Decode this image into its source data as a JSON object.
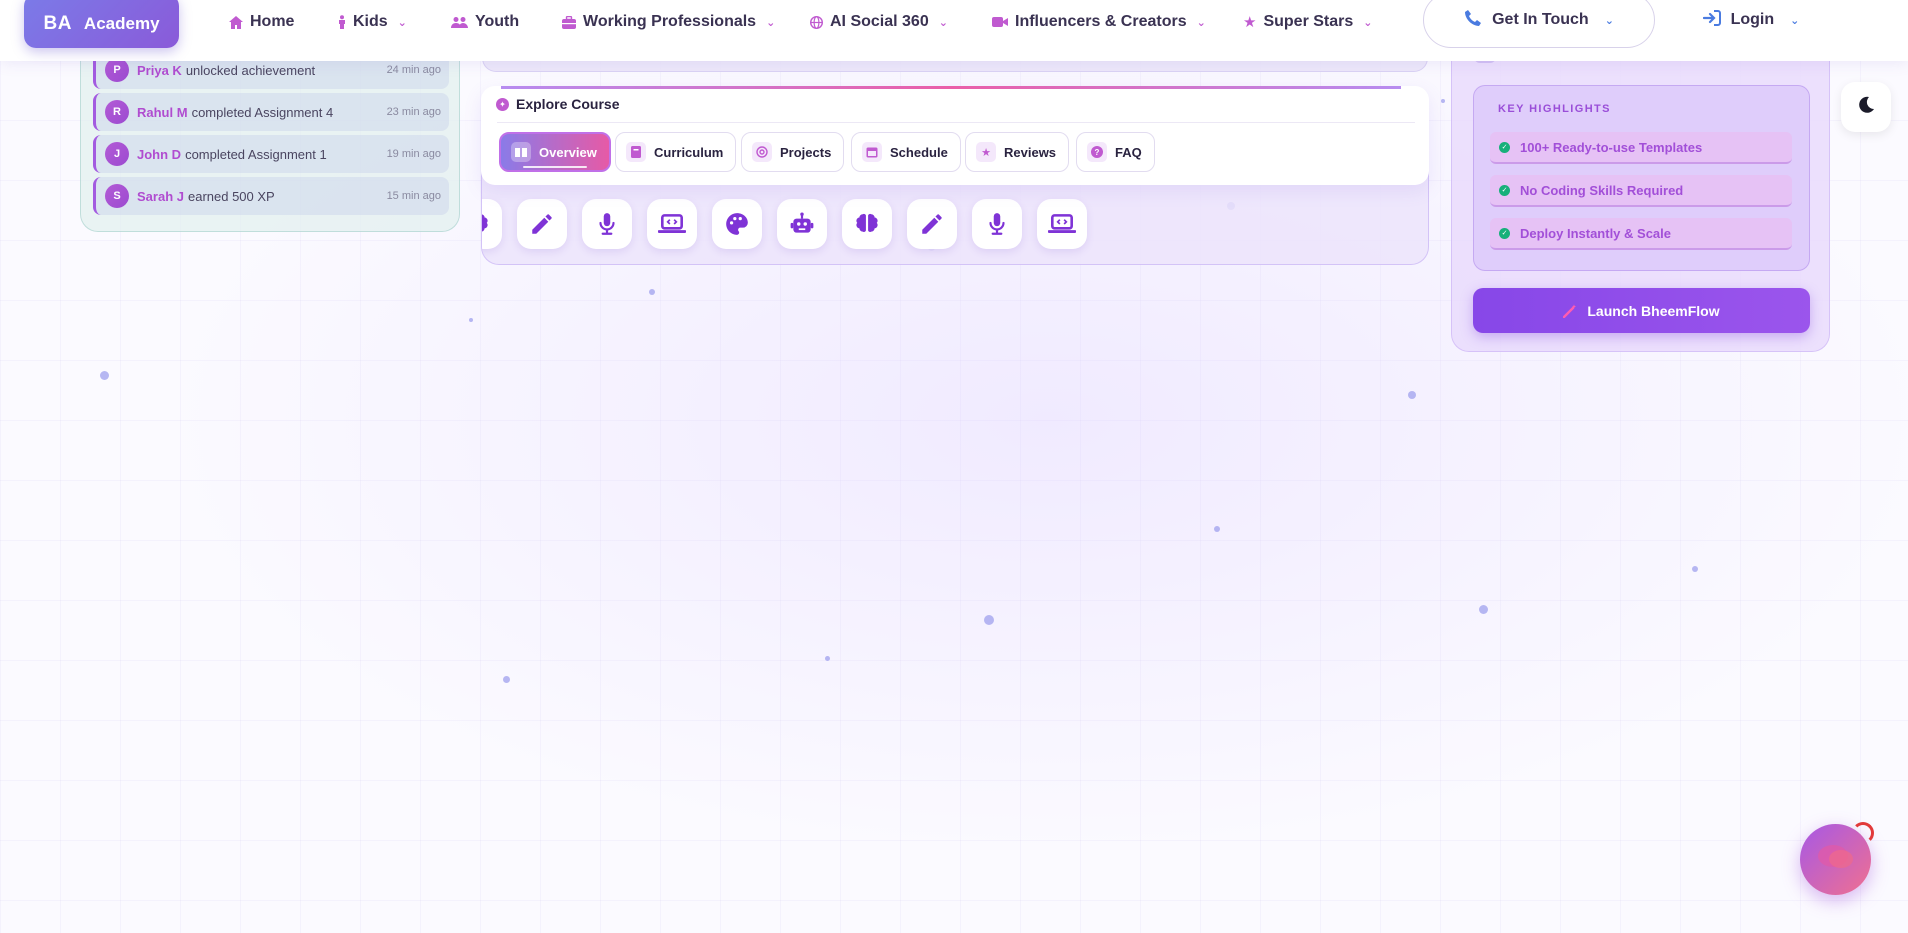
{
  "brand": {
    "initials": "BA",
    "name": "Academy"
  },
  "nav": {
    "items": [
      {
        "label": "Home",
        "icon": "home-icon"
      },
      {
        "label": "Kids",
        "icon": "child-icon",
        "dropdown": true
      },
      {
        "label": "Youth",
        "icon": "users-icon"
      },
      {
        "label": "Working Professionals",
        "icon": "briefcase-icon",
        "dropdown": true
      },
      {
        "label": "AI Social 360",
        "icon": "globe-icon",
        "dropdown": true
      },
      {
        "label": "Influencers & Creators",
        "icon": "video-icon",
        "dropdown": true
      },
      {
        "label": "Super Stars",
        "icon": "star-icon",
        "dropdown": true
      }
    ],
    "get_in_touch": "Get In Touch",
    "login": "Login"
  },
  "activity": {
    "items": [
      {
        "initial": "P",
        "name": "Priya K",
        "action": "unlocked achievement",
        "time": "24 min ago"
      },
      {
        "initial": "R",
        "name": "Rahul M",
        "action": "completed Assignment 4",
        "time": "23 min ago"
      },
      {
        "initial": "J",
        "name": "John D",
        "action": "completed Assignment 1",
        "time": "19 min ago"
      },
      {
        "initial": "S",
        "name": "Sarah J",
        "action": "earned 500 XP",
        "time": "15 min ago"
      }
    ]
  },
  "course": {
    "title": "Explore Course",
    "tabs": [
      {
        "label": "Overview",
        "icon": "book-open-icon",
        "active": true
      },
      {
        "label": "Curriculum",
        "icon": "book-icon"
      },
      {
        "label": "Projects",
        "icon": "target-icon"
      },
      {
        "label": "Schedule",
        "icon": "calendar-icon"
      },
      {
        "label": "Reviews",
        "icon": "star-icon"
      },
      {
        "label": "FAQ",
        "icon": "question-icon"
      }
    ],
    "strip_icons": [
      "brain-icon",
      "pencil-icon",
      "microphone-icon",
      "laptop-code-icon",
      "palette-icon",
      "robot-icon",
      "brain-icon",
      "pencil-icon",
      "microphone-icon",
      "laptop-code-icon"
    ]
  },
  "highlights": {
    "title": "KEY HIGHLIGHTS",
    "items": [
      "100+ Ready-to-use Templates",
      "No Coding Skills Required",
      "Deploy Instantly & Scale"
    ],
    "launch_label": "Launch BheemFlow"
  },
  "colors": {
    "accent": "#8747e8",
    "pink": "#e65aa6",
    "nav_icon": "#c05ad0",
    "check": "#17b07a"
  }
}
